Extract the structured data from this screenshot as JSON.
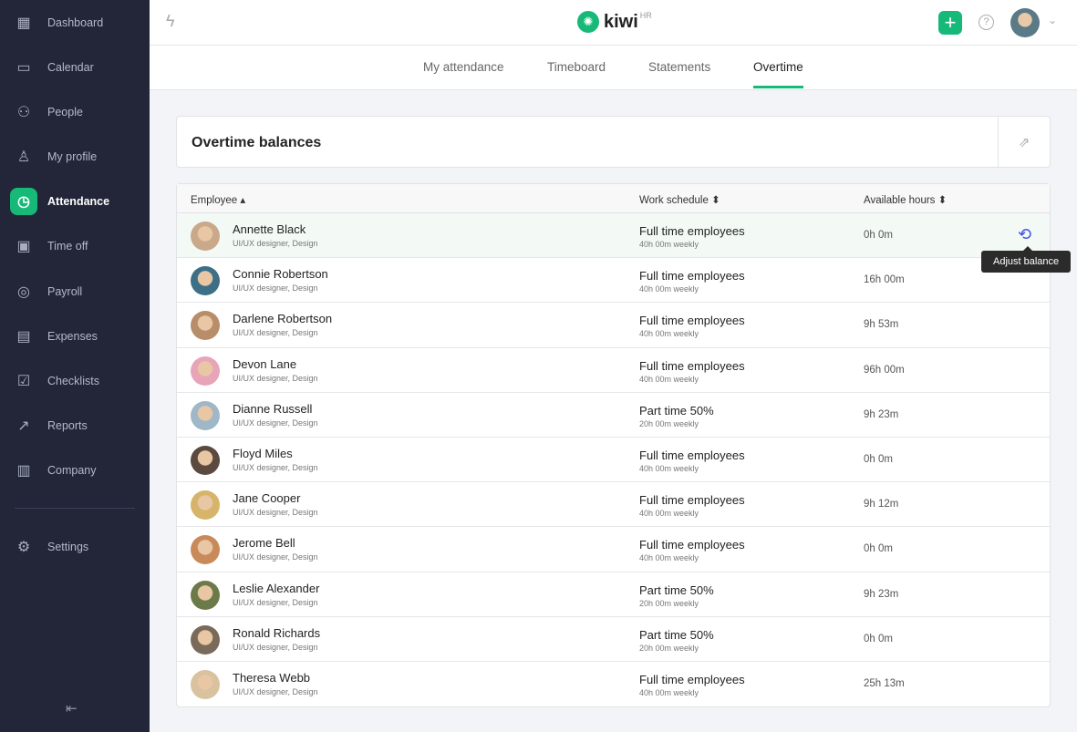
{
  "sidebar": {
    "items": [
      {
        "label": "Dashboard",
        "icon": "grid-icon",
        "glyph": "▦"
      },
      {
        "label": "Calendar",
        "icon": "calendar-icon",
        "glyph": "▭"
      },
      {
        "label": "People",
        "icon": "people-icon",
        "glyph": "⚇"
      },
      {
        "label": "My profile",
        "icon": "user-icon",
        "glyph": "♙"
      },
      {
        "label": "Attendance",
        "icon": "stopwatch-icon",
        "glyph": "◷",
        "active": true
      },
      {
        "label": "Time off",
        "icon": "calendar-clock-icon",
        "glyph": "▣"
      },
      {
        "label": "Payroll",
        "icon": "payroll-icon",
        "glyph": "◎"
      },
      {
        "label": "Expenses",
        "icon": "wallet-icon",
        "glyph": "▤"
      },
      {
        "label": "Checklists",
        "icon": "checklist-icon",
        "glyph": "☑"
      },
      {
        "label": "Reports",
        "icon": "chart-icon",
        "glyph": "↗"
      },
      {
        "label": "Company",
        "icon": "building-icon",
        "glyph": "▥"
      },
      {
        "label": "Settings",
        "icon": "gear-icon",
        "glyph": "⚙"
      }
    ]
  },
  "header": {
    "logo": "kiwi",
    "logo_sup": "HR"
  },
  "tabs": [
    "My attendance",
    "Timeboard",
    "Statements",
    "Overtime"
  ],
  "active_tab": "Overtime",
  "card": {
    "title": "Overtime balances"
  },
  "table": {
    "columns": [
      "Employee",
      "Work schedule",
      "Available hours"
    ],
    "rows": [
      {
        "name": "Annette Black",
        "role": "UI/UX designer, Design",
        "schedule": "Full time employees",
        "weekly": "40h 00m weekly",
        "hours": "0h 0m"
      },
      {
        "name": "Connie Robertson",
        "role": "UI/UX designer, Design",
        "schedule": "Full time employees",
        "weekly": "40h 00m weekly",
        "hours": "16h 00m"
      },
      {
        "name": "Darlene Robertson",
        "role": "UI/UX designer, Design",
        "schedule": "Full time employees",
        "weekly": "40h 00m weekly",
        "hours": "9h 53m"
      },
      {
        "name": "Devon Lane",
        "role": "UI/UX designer, Design",
        "schedule": "Full time employees",
        "weekly": "40h 00m weekly",
        "hours": "96h 00m"
      },
      {
        "name": "Dianne Russell",
        "role": "UI/UX designer, Design",
        "schedule": "Part time 50%",
        "weekly": "20h 00m weekly",
        "hours": "9h 23m"
      },
      {
        "name": "Floyd Miles",
        "role": "UI/UX designer, Design",
        "schedule": "Full time employees",
        "weekly": "40h 00m weekly",
        "hours": "0h 0m"
      },
      {
        "name": "Jane Cooper",
        "role": "UI/UX designer, Design",
        "schedule": "Full time employees",
        "weekly": "40h 00m weekly",
        "hours": "9h 12m"
      },
      {
        "name": "Jerome Bell",
        "role": "UI/UX designer, Design",
        "schedule": "Full time employees",
        "weekly": "40h 00m weekly",
        "hours": "0h 0m"
      },
      {
        "name": "Leslie Alexander",
        "role": "UI/UX designer, Design",
        "schedule": "Part time 50%",
        "weekly": "20h 00m weekly",
        "hours": "9h 23m"
      },
      {
        "name": "Ronald Richards",
        "role": "UI/UX designer, Design",
        "schedule": "Part time 50%",
        "weekly": "20h 00m weekly",
        "hours": "0h 0m"
      },
      {
        "name": "Theresa Webb",
        "role": "UI/UX designer, Design",
        "schedule": "Full time employees",
        "weekly": "40h 00m weekly",
        "hours": "25h 13m"
      }
    ]
  },
  "tooltip": "Adjust balance",
  "colors": {
    "accent": "#17b978",
    "sidebar": "#232639",
    "adjust_icon": "#3f51e8"
  }
}
